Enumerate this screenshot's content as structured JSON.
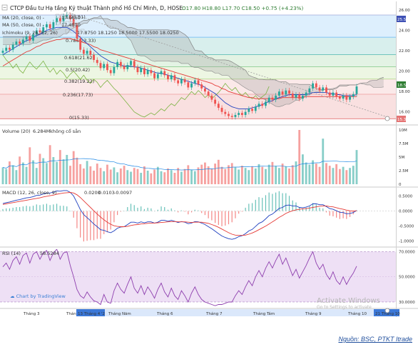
{
  "header": {
    "symbol": "CTCP Đầu tư Hạ tầng Kỹ thuật Thành phố Hồ Chí Minh, D, HOSE",
    "ohlc": "O17.80  H18.80  L17.70  C18.50  +0.75 (+4.23%)",
    "ma20": "MA (20, close, 0) -",
    "ma20_val": "17.6650",
    "ma50": "MA (50, close, 0) -",
    "ma50_val": "17.4810",
    "ichimoku": "Ichimoku (9, 26, 52, 26)",
    "ichimoku_vals": "17.8750  18.1250  18.5000  17.5500  18.0250"
  },
  "colors": {
    "up": "#26a69a",
    "down": "#ef5350",
    "ma20": "#1e3fbf",
    "ma50": "#e53935",
    "lagging": "#7cb342",
    "cloud": "#999999",
    "rsi_fill": "#ead8f2",
    "rsi_line": "#8e3fae",
    "fib_0": "#e57373",
    "fib_236": "#ef9a9a",
    "fib_382": "#aed581",
    "fib_5": "#81c784",
    "fib_618": "#4db6ac",
    "fib_786": "#64b5f6",
    "fib_1": "#9fa8da"
  },
  "fib_labels": [
    "0(15.33)",
    "0.236(17.73)",
    "0.382(19.22)",
    "0.5(20.42)",
    "0.618(21.62)",
    "0.786(23.33)",
    "1(25.51)"
  ],
  "price_tags": {
    "top": "25.51",
    "last": "18.50",
    "bottom": "15.33"
  },
  "volume": {
    "title": "Volume (20)",
    "value": "6.284M",
    "extra": "không cổ sẵn",
    "axis": [
      "10M",
      "7.5M",
      "5M",
      "2.5M",
      "0"
    ]
  },
  "macd": {
    "title": "MACD (12, 26, close, 9)",
    "v1": "0.0200",
    "v2": "0.0103",
    "v3": "-0.0097",
    "axis": [
      "0.5000",
      "0.0000",
      "-0.5000",
      "-1.0000"
    ]
  },
  "rsi": {
    "title": "RSI (14)",
    "value": "58.5284",
    "axis": [
      "70.0000",
      "50.0000",
      "30.0000"
    ]
  },
  "xaxis": {
    "labels": [
      "Tháng 3",
      "Tháng",
      "Tháng Năm",
      "Tháng 6",
      "Tháng 7",
      "Tháng Tám",
      "Tháng 9",
      "Tháng 10"
    ],
    "left_tag": "13 Tháng 4 '21",
    "right_tag": "21 Tháng 10"
  },
  "watermark": {
    "line1": "Activate Windows",
    "line2": "Go to Settings to activate"
  },
  "logo": "Chart by TradingView",
  "source": "Nguồn: BSC, PTKT Itrade",
  "chart_data": [
    {
      "type": "candlestick",
      "title": "CTCP Đầu tư Hạ tầng Kỹ thuật Thành phố Hồ Chí Minh, D, HOSE",
      "ylim": [
        15,
        26
      ],
      "yticks": [
        16,
        18,
        20,
        22,
        24,
        26
      ],
      "close": [
        22.0,
        22.3,
        22.1,
        22.6,
        22.9,
        22.7,
        23.1,
        23.4,
        23.0,
        23.6,
        24.0,
        23.8,
        24.3,
        24.6,
        24.2,
        24.8,
        25.2,
        24.9,
        25.4,
        25.5,
        25.1,
        24.5,
        23.2,
        22.1,
        21.7,
        22.0,
        21.6,
        21.1,
        20.8,
        20.3,
        20.7,
        20.1,
        19.8,
        20.4,
        20.9,
        20.5,
        20.2,
        20.6,
        21.0,
        20.4,
        19.9,
        20.3,
        19.7,
        20.1,
        19.8,
        19.3,
        19.7,
        20.0,
        19.6,
        19.2,
        19.6,
        19.1,
        18.8,
        19.2,
        18.9,
        18.4,
        18.8,
        19.1,
        18.7,
        18.3,
        18.0,
        17.6,
        17.2,
        16.8,
        16.4,
        16.0,
        15.8,
        15.6,
        15.5,
        15.7,
        15.9,
        15.7,
        16.0,
        16.3,
        16.1,
        16.5,
        16.8,
        16.6,
        17.0,
        17.4,
        17.2,
        17.6,
        18.0,
        17.7,
        18.1,
        17.8,
        17.4,
        17.7,
        17.3,
        17.6,
        17.9,
        18.3,
        18.8,
        18.4,
        18.1,
        18.4,
        17.9,
        17.6,
        17.9,
        17.5,
        17.3,
        17.6,
        17.2,
        17.5,
        17.75,
        18.5
      ],
      "ma20": [
        21.6,
        21.8,
        22.0,
        22.2,
        22.4,
        22.6,
        22.8,
        23.0,
        23.1,
        23.3,
        23.5,
        23.6,
        23.8,
        24.0,
        24.1,
        24.2,
        24.3,
        24.3,
        24.3,
        24.3,
        24.1,
        23.9,
        23.6,
        23.3,
        23.0,
        22.7,
        22.4,
        22.1,
        21.8,
        21.5,
        21.3,
        21.1,
        20.9,
        20.8,
        20.7,
        20.6,
        20.5,
        20.5,
        20.5,
        20.4,
        20.4,
        20.3,
        20.2,
        20.1,
        20.0,
        19.9,
        19.8,
        19.8,
        19.7,
        19.6,
        19.5,
        19.4,
        19.3,
        19.2,
        19.1,
        19.0,
        18.9,
        18.8,
        18.7,
        18.6,
        18.4,
        18.2,
        18.0,
        17.8,
        17.5,
        17.2,
        16.9,
        16.7,
        16.5,
        16.4,
        16.3,
        16.3,
        16.3,
        16.3,
        16.4,
        16.5,
        16.6,
        16.7,
        16.9,
        17.0,
        17.1,
        17.3,
        17.4,
        17.5,
        17.6,
        17.7,
        17.7,
        17.7,
        17.7,
        17.7,
        17.7,
        17.8,
        17.9,
        17.9,
        17.9,
        17.9,
        17.9,
        17.8,
        17.8,
        17.7,
        17.7,
        17.6,
        17.6,
        17.6,
        17.6,
        17.7
      ],
      "ma50": [
        20.5,
        20.7,
        20.9,
        21.1,
        21.3,
        21.5,
        21.7,
        21.9,
        22.0,
        22.2,
        22.4,
        22.5,
        22.7,
        22.8,
        22.9,
        23.0,
        23.1,
        23.1,
        23.2,
        23.2,
        23.2,
        23.1,
        23.0,
        22.9,
        22.8,
        22.7,
        22.6,
        22.4,
        22.3,
        22.1,
        22.0,
        21.9,
        21.8,
        21.7,
        21.6,
        21.5,
        21.4,
        21.3,
        21.2,
        21.1,
        21.0,
        20.9,
        20.8,
        20.7,
        20.6,
        20.5,
        20.4,
        20.3,
        20.2,
        20.1,
        20.0,
        19.9,
        19.8,
        19.7,
        19.6,
        19.5,
        19.4,
        19.3,
        19.2,
        19.1,
        19.0,
        18.9,
        18.8,
        18.6,
        18.5,
        18.3,
        18.2,
        18.0,
        17.9,
        17.8,
        17.7,
        17.6,
        17.5,
        17.4,
        17.4,
        17.3,
        17.3,
        17.3,
        17.3,
        17.3,
        17.3,
        17.3,
        17.3,
        17.4,
        17.4,
        17.4,
        17.4,
        17.4,
        17.4,
        17.4,
        17.5,
        17.5,
        17.5,
        17.5,
        17.5,
        17.5,
        17.5,
        17.5,
        17.5,
        17.5,
        17.5,
        17.5,
        17.5,
        17.5,
        17.5,
        17.5
      ]
    },
    {
      "type": "bar",
      "title": "Volume (20)",
      "ylim": [
        0,
        10
      ],
      "yunit": "M",
      "values": [
        3.1,
        2.8,
        4.2,
        3.5,
        2.6,
        5.1,
        4.0,
        3.2,
        6.8,
        4.4,
        3.0,
        5.6,
        4.8,
        3.9,
        7.2,
        5.0,
        4.1,
        6.3,
        4.6,
        5.4,
        3.4,
        6.1,
        4.9,
        3.7,
        2.9,
        4.3,
        3.3,
        2.5,
        3.8,
        3.0,
        2.4,
        3.6,
        2.7,
        3.1,
        2.2,
        2.9,
        3.4,
        2.6,
        2.3,
        3.0,
        2.8,
        2.1,
        3.3,
        2.5,
        2.0,
        2.7,
        3.2,
        2.4,
        2.2,
        2.9,
        2.6,
        2.1,
        3.0,
        2.3,
        2.8,
        3.5,
        2.7,
        2.4,
        3.1,
        3.6,
        4.0,
        3.3,
        2.9,
        3.8,
        4.5,
        3.2,
        2.8,
        3.5,
        3.9,
        3.1,
        2.7,
        3.4,
        3.0,
        2.6,
        3.3,
        2.9,
        3.7,
        3.2,
        2.8,
        3.6,
        4.1,
        3.4,
        3.0,
        3.8,
        3.3,
        2.9,
        3.5,
        4.2,
        10.0,
        5.5,
        4.0,
        3.6,
        4.4,
        3.8,
        3.2,
        8.4,
        3.9,
        3.4,
        3.0,
        3.7,
        2.8,
        3.2,
        2.6,
        3.0,
        3.4,
        6.3
      ],
      "up": [
        1,
        1,
        0,
        1,
        1,
        0,
        1,
        1,
        0,
        1,
        1,
        0,
        1,
        1,
        0,
        1,
        1,
        0,
        1,
        1,
        0,
        0,
        0,
        0,
        0,
        1,
        0,
        0,
        0,
        0,
        1,
        0,
        0,
        1,
        1,
        0,
        0,
        1,
        1,
        0,
        0,
        1,
        0,
        1,
        0,
        0,
        1,
        1,
        0,
        0,
        1,
        0,
        0,
        1,
        0,
        0,
        1,
        1,
        0,
        0,
        0,
        0,
        0,
        0,
        0,
        0,
        0,
        0,
        0,
        1,
        1,
        0,
        1,
        1,
        0,
        1,
        1,
        0,
        1,
        1,
        0,
        1,
        1,
        0,
        1,
        0,
        0,
        1,
        0,
        1,
        1,
        1,
        1,
        0,
        0,
        1,
        0,
        0,
        1,
        0,
        0,
        1,
        0,
        1,
        1,
        1
      ]
    },
    {
      "type": "line",
      "title": "MACD (12, 26, close, 9)",
      "ylim": [
        -1.15,
        0.75
      ],
      "series": [
        {
          "values": [
            0.25,
            0.28,
            0.3,
            0.33,
            0.36,
            0.38,
            0.41,
            0.44,
            0.45,
            0.48,
            0.52,
            0.53,
            0.57,
            0.6,
            0.6,
            0.63,
            0.67,
            0.66,
            0.68,
            0.68,
            0.62,
            0.5,
            0.28,
            0.05,
            -0.12,
            -0.22,
            -0.32,
            -0.43,
            -0.52,
            -0.62,
            -0.64,
            -0.69,
            -0.72,
            -0.66,
            -0.57,
            -0.53,
            -0.52,
            -0.45,
            -0.37,
            -0.37,
            -0.4,
            -0.36,
            -0.39,
            -0.36,
            -0.36,
            -0.4,
            -0.37,
            -0.31,
            -0.31,
            -0.34,
            -0.31,
            -0.34,
            -0.38,
            -0.35,
            -0.37,
            -0.42,
            -0.4,
            -0.35,
            -0.36,
            -0.4,
            -0.45,
            -0.52,
            -0.59,
            -0.67,
            -0.75,
            -0.83,
            -0.88,
            -0.92,
            -0.94,
            -0.91,
            -0.85,
            -0.82,
            -0.75,
            -0.66,
            -0.61,
            -0.51,
            -0.41,
            -0.36,
            -0.26,
            -0.15,
            -0.1,
            -0.01,
            0.09,
            0.12,
            0.19,
            0.2,
            0.17,
            0.17,
            0.12,
            0.11,
            0.13,
            0.17,
            0.24,
            0.24,
            0.21,
            0.21,
            0.15,
            0.08,
            0.06,
            0.01,
            -0.04,
            -0.05,
            -0.09,
            -0.08,
            -0.05,
            0.02
          ]
        },
        {
          "values": [
            0.22,
            0.24,
            0.26,
            0.28,
            0.3,
            0.32,
            0.34,
            0.36,
            0.38,
            0.4,
            0.42,
            0.44,
            0.47,
            0.49,
            0.51,
            0.53,
            0.56,
            0.58,
            0.6,
            0.61,
            0.62,
            0.6,
            0.54,
            0.45,
            0.34,
            0.23,
            0.12,
            0.01,
            -0.1,
            -0.2,
            -0.29,
            -0.37,
            -0.44,
            -0.49,
            -0.51,
            -0.52,
            -0.52,
            -0.51,
            -0.48,
            -0.46,
            -0.45,
            -0.43,
            -0.42,
            -0.41,
            -0.4,
            -0.4,
            -0.39,
            -0.38,
            -0.37,
            -0.36,
            -0.35,
            -0.35,
            -0.36,
            -0.36,
            -0.36,
            -0.37,
            -0.38,
            -0.37,
            -0.37,
            -0.37,
            -0.39,
            -0.41,
            -0.45,
            -0.49,
            -0.54,
            -0.6,
            -0.66,
            -0.72,
            -0.77,
            -0.8,
            -0.81,
            -0.81,
            -0.8,
            -0.77,
            -0.73,
            -0.68,
            -0.62,
            -0.56,
            -0.5,
            -0.43,
            -0.36,
            -0.29,
            -0.21,
            -0.15,
            -0.08,
            -0.03,
            0.01,
            0.04,
            0.06,
            0.07,
            0.08,
            0.1,
            0.12,
            0.14,
            0.16,
            0.17,
            0.17,
            0.15,
            0.14,
            0.11,
            0.08,
            0.06,
            0.03,
            0.01,
            0.0,
            0.01
          ]
        }
      ]
    },
    {
      "type": "line",
      "title": "RSI (14)",
      "ylim": [
        26,
        72
      ],
      "series": [
        {
          "values": [
            58,
            61,
            56,
            63,
            66,
            60,
            67,
            69,
            61,
            68,
            70,
            64,
            69,
            71,
            63,
            69,
            72,
            64,
            69,
            70,
            59,
            50,
            40,
            35,
            33,
            38,
            34,
            31,
            30,
            28,
            36,
            30,
            29,
            39,
            45,
            40,
            37,
            44,
            50,
            41,
            37,
            43,
            36,
            42,
            38,
            33,
            40,
            45,
            38,
            34,
            41,
            35,
            32,
            39,
            35,
            30,
            37,
            42,
            36,
            32,
            30,
            29,
            28,
            27,
            28,
            28,
            29,
            30,
            30,
            35,
            39,
            36,
            42,
            47,
            43,
            50,
            55,
            50,
            57,
            62,
            57,
            63,
            68,
            60,
            65,
            58,
            51,
            56,
            49,
            54,
            59,
            65,
            70,
            61,
            56,
            60,
            52,
            48,
            54,
            47,
            44,
            50,
            44,
            49,
            53,
            58.5
          ]
        }
      ]
    }
  ]
}
